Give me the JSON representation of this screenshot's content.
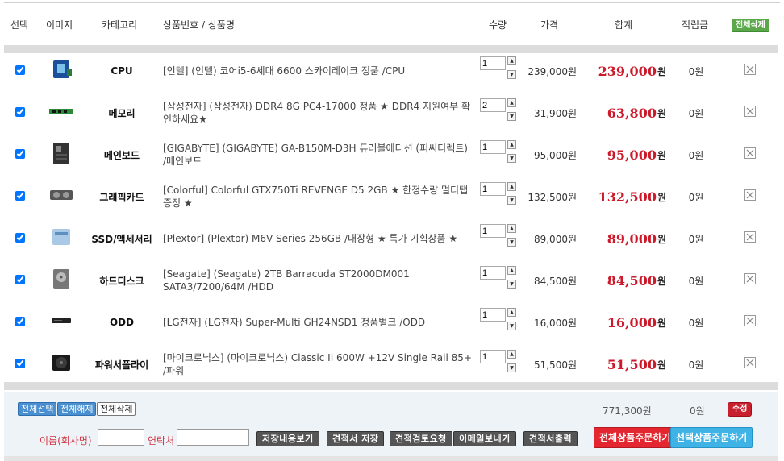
{
  "header": {
    "select": "선택",
    "image": "이미지",
    "category": "카테고리",
    "product": "상품번호 / 상품명",
    "qty": "수량",
    "price": "가격",
    "total": "합계",
    "points": "적립금",
    "delete_all": "전체삭제"
  },
  "currency_suffix": "원",
  "items": [
    {
      "category": "CPU",
      "name": "[인텔] (인텔) 코어i5-6세대 6600 스카이레이크 정품 /CPU",
      "qty": "1",
      "price": "239,000원",
      "total": "239,000",
      "points": "0원",
      "icon": "cpu-icon"
    },
    {
      "category": "메모리",
      "name": "[삼성전자] (삼성전자) DDR4 8G PC4-17000 정품 ★ DDR4 지원여부 확인하세요★",
      "qty": "2",
      "price": "31,900원",
      "total": "63,800",
      "points": "0원",
      "icon": "memory-icon"
    },
    {
      "category": "메인보드",
      "name": "[GIGABYTE] (GIGABYTE) GA-B150M-D3H 듀러블에디션 (피씨디렉트) /메인보드",
      "qty": "1",
      "price": "95,000원",
      "total": "95,000",
      "points": "0원",
      "icon": "mainboard-icon"
    },
    {
      "category": "그래픽카드",
      "name": "[Colorful] Colorful GTX750Ti REVENGE D5 2GB ★ 한정수량 멀티탭 증정 ★",
      "qty": "1",
      "price": "132,500원",
      "total": "132,500",
      "points": "0원",
      "icon": "graphics-card-icon"
    },
    {
      "category": "SSD/액세서리",
      "name": "[Plextor] (Plextor) M6V Series 256GB /내장형 ★ 특가 기획상품 ★",
      "qty": "1",
      "price": "89,000원",
      "total": "89,000",
      "points": "0원",
      "icon": "ssd-icon"
    },
    {
      "category": "하드디스크",
      "name": "[Seagate] (Seagate) 2TB Barracuda ST2000DM001 SATA3/7200/64M /HDD",
      "qty": "1",
      "price": "84,500원",
      "total": "84,500",
      "points": "0원",
      "icon": "hdd-icon"
    },
    {
      "category": "ODD",
      "name": "[LG전자] (LG전자) Super-Multi GH24NSD1 정품벌크 /ODD",
      "qty": "1",
      "price": "16,000원",
      "total": "16,000",
      "points": "0원",
      "icon": "odd-icon"
    },
    {
      "category": "파워서플라이",
      "name": "[마이크로닉스] (마이크로닉스) Classic II 600W +12V Single Rail 85+ /파워",
      "qty": "1",
      "price": "51,500원",
      "total": "51,500",
      "points": "0원",
      "icon": "psu-icon"
    }
  ],
  "footer": {
    "select_all": "전체선택",
    "deselect_all": "전체해제",
    "delete_selected": "전체삭제",
    "sum_total": "771,300원",
    "sum_points": "0원",
    "edit": "수정",
    "name_label": "이름(회사명)",
    "contact_label": "연락처",
    "buttons": [
      "저장내용보기",
      "견적서 저장",
      "견적검토요청",
      "이메일보내기",
      "견적서출력"
    ],
    "order_all": "전체상품주문하기",
    "order_selected": "선택상품주문하기"
  },
  "colors": {
    "accent_red": "#cc1a2a",
    "green": "#5aa84a",
    "blue": "#3fb3e6"
  }
}
